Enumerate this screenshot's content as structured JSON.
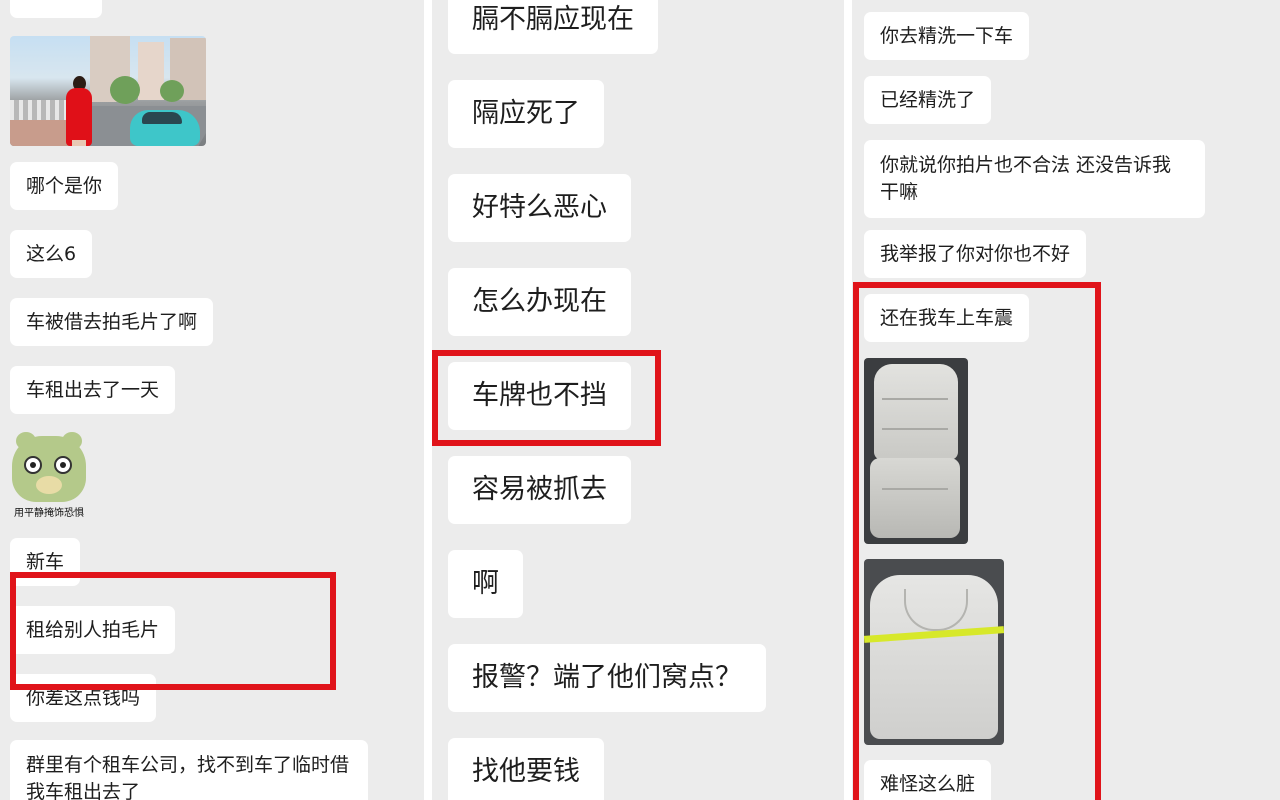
{
  "panel1": {
    "photo_alt": "woman in red dress with teal car",
    "sticker_caption": "用平静掩饰恐惧",
    "messages": [
      "哪个是你",
      "这么6",
      "车被借去拍毛片了啊",
      "车租出去了一天",
      "新车",
      "租给别人拍毛片",
      "你差这点钱吗",
      "群里有个租车公司，找不到车了临时借我车租出去了"
    ]
  },
  "panel2": {
    "messages": [
      "膈不膈应现在",
      "隔应死了",
      "好特么恶心",
      "怎么办现在",
      "车牌也不挡",
      "容易被抓去",
      "啊",
      "报警？端了他们窝点？",
      "找他要钱"
    ]
  },
  "panel3": {
    "messages": [
      "你去精洗一下车",
      "已经精洗了",
      "你就说你拍片也不合法 还没告诉我干嘛",
      "我举报了你对你也不好",
      "还在我车上车震",
      "难怪这么脏"
    ]
  },
  "highlight_color": "#e0141a"
}
